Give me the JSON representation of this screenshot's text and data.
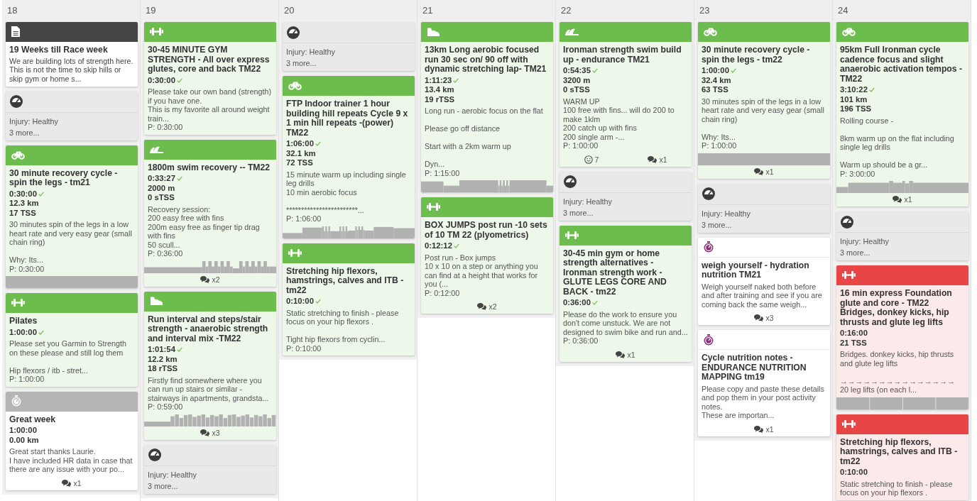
{
  "days": [
    {
      "label": "18",
      "items": [
        {
          "kind": "note",
          "title": "19 Weeks till Race week",
          "text": "We are building lots of strength here. This is not the time to skip hills or skip gym or home s..."
        },
        {
          "kind": "metrics",
          "lines": [
            "Injury: Healthy"
          ],
          "more": "3 more..."
        },
        {
          "kind": "bike",
          "color": "#6cbc4e",
          "title": "30 minute recovery cycle - spin the legs - tm21",
          "duration": "0:30:00",
          "completed": true,
          "distance": "12.3 km",
          "load": "17 TSS",
          "description": "30 minutes spin of the legs in a low heart rate and very easy gear (small chain ring)\n\nWhy: Its...",
          "planned": "P: 0:30:00",
          "graph": {
            "kind": "flat"
          }
        },
        {
          "kind": "strength",
          "color": "#6cbc4e",
          "title": "Pilates",
          "duration": "1:00:00",
          "completed": true,
          "description": "Please set you Garmin to Strength on these please and still log them\n\nHip flexors / itb - stret...",
          "planned": "P: 1:00:00"
        },
        {
          "kind": "other",
          "color": "#b5b5b5",
          "title": "Great week",
          "duration": "1:00:00",
          "completed": false,
          "distance": "0.00 km",
          "description": "Great start thanks Laurie.\nI have included HR data in case that there are any issue with your po...",
          "comments": "x1"
        }
      ]
    },
    {
      "label": "19",
      "items": [
        {
          "kind": "strength",
          "color": "#6cbc4e",
          "title": "30-45 MINUTE GYM STRENGTH - All over express glutes, core and back TM22",
          "duration": "0:30:00",
          "completed": true,
          "description": "Please take our own band (strength) if you have one.\nThis is my favorite all around weight train...",
          "planned": "P: 0:30:00"
        },
        {
          "kind": "swim",
          "color": "#6cbc4e",
          "title": "1800m swim recovery -- TM22",
          "duration": "0:33:27",
          "completed": true,
          "distance": "2000 m",
          "load": "0 sTSS",
          "description": "Recovery session:\n200 easy free with fins\n200m easy free as finger tip drag with fins\n50 scull...",
          "planned": "P: 0:36:00",
          "graph": {
            "kind": "swim"
          },
          "comments": "x2"
        },
        {
          "kind": "run",
          "color": "#6cbc4e",
          "title": "Run interval and steps/stair strength - anaerobic strength and interval mix -TM22",
          "duration": "1:01:54",
          "completed": true,
          "distance": "12.2 km",
          "load": "18 rTSS",
          "description": "Firstly find somewhere where you can run up stairs or similar - stairways in apartments, grandsta...",
          "planned": "P: 0:59:00",
          "graph": {
            "kind": "run"
          },
          "comments": "x3"
        },
        {
          "kind": "metrics",
          "lines": [
            "Injury: Healthy"
          ],
          "more": "3 more..."
        }
      ]
    },
    {
      "label": "20",
      "items": [
        {
          "kind": "metrics",
          "lines": [
            "Injury: Healthy"
          ],
          "more": "3 more..."
        },
        {
          "kind": "bike",
          "color": "#6cbc4e",
          "title": "FTP Indoor trainer 1 hour building hill repeats Cycle 9 x 1 min hill repeats -(power) TM22",
          "duration": "1:06:00",
          "completed": true,
          "distance": "32.1 km",
          "load": "72 TSS",
          "description": "15 minute warm up including single leg drills\n10 min aerobic focus\n\n************************...",
          "planned": "P: 1:06:00",
          "graph": {
            "kind": "ftp"
          }
        },
        {
          "kind": "strength",
          "color": "#6cbc4e",
          "title": "Stretching hip flexors, hamstrings, calves and ITB - tm22",
          "duration": "0:10:00",
          "completed": true,
          "description": "Static stretching to finish - please focus on your hip flexors .\n\nTight hip flexors from cyclin...",
          "planned": "P: 0:10:00"
        }
      ]
    },
    {
      "label": "21",
      "items": [
        {
          "kind": "run",
          "color": "#6cbc4e",
          "title": "13km Long aerobic focused run 30 sec on/ 90 off with dynamic stretching lap- TM21",
          "duration": "1:11:23",
          "completed": true,
          "distance": "13.4 km",
          "load": "19 rTSS",
          "description": "Long run - aerobic focus on the flat\n\nPlease go off distance\n\nStart with a 2km warm up\n\nDyn...",
          "planned": "P: 1:15:00",
          "graph": {
            "kind": "long_run"
          }
        },
        {
          "kind": "strength",
          "color": "#6cbc4e",
          "title": "BOX JUMPS post run -10 sets of 10 TM 22 (plyometrics)",
          "duration": "0:12:12",
          "completed": true,
          "description": "Post run - Box jumps\n10 x 10 on a step or anything you can find at a height that works for you (...",
          "planned": "P: 0:12:00",
          "comments": "x2"
        }
      ]
    },
    {
      "label": "22",
      "items": [
        {
          "kind": "swim",
          "color": "#6cbc4e",
          "title": "Ironman strength swim build up - endurance TM21",
          "duration": "0:54:35",
          "completed": true,
          "distance": "3200 m",
          "load": "0 sTSS",
          "description": "WARM UP\n100 free with fins... will do 200 to make 1klm\n200 catch up with fins\n200 single arm -...",
          "planned": "P: 1:00:00",
          "feel": "7",
          "comments": "x1"
        },
        {
          "kind": "metrics",
          "lines": [
            "Injury: Healthy"
          ],
          "more": "3 more..."
        },
        {
          "kind": "strength",
          "color": "#6cbc4e",
          "title": "30-45 min gym or home strength alternatives - Ironman strength work - GLUTE LEGS CORE AND BACK - tm22",
          "duration": "0:36:00",
          "completed": true,
          "description": "Please do the work to ensure you don't come unstuck. We are not designed to swim bike and run and...",
          "planned": "P: 0:36:00",
          "comments": "x1"
        }
      ]
    },
    {
      "label": "23",
      "items": [
        {
          "kind": "bike",
          "color": "#6cbc4e",
          "title": "30 minute recovery cycle - spin the legs - tm22",
          "duration": "1:00:00",
          "completed": true,
          "distance": "32.4 km",
          "load": "63 TSS",
          "description": "30 minutes spin of the legs in a low heart rate and very easy gear (small chain ring)\n\nWhy: Its...",
          "planned": "P: 1:00:00",
          "graph": {
            "kind": "flat"
          },
          "comments": "x1"
        },
        {
          "kind": "metrics",
          "lines": [
            "Injury: Healthy"
          ],
          "more": "3 more..."
        },
        {
          "kind": "other",
          "color": "#ffffff",
          "title": "weigh yourself - hydration nutrition TM21",
          "description": "Weigh yourself naked both before and after training and see if you are coming back the same weigh...",
          "comments": "x3"
        },
        {
          "kind": "other",
          "color": "#ffffff",
          "title": "Cycle nutrition notes - ENDURANCE NUTRITION MAPPING tm19",
          "description": "Please copy and paste these details and pop them in your post activity notes.\nThese are importan...",
          "comments": "x1"
        }
      ]
    },
    {
      "label": "24",
      "items": [
        {
          "kind": "bike",
          "color": "#6cbc4e",
          "title": "95km Full Ironman cycle cadence focus and slight anaerobic activation tempos - TM22",
          "duration": "3:10:22",
          "completed": true,
          "distance": "101 km",
          "load": "196 TSS",
          "description": "Rolling course -\n\n8km warm up on the flat including single leg drills\n\nWarm up should be a gr...",
          "planned": "P: 3:00:00",
          "graph": {
            "kind": "endurance"
          },
          "comments": "x1"
        },
        {
          "kind": "metrics",
          "lines": [
            "Injury: Healthy"
          ],
          "more": "3 more..."
        },
        {
          "kind": "strength",
          "color": "#e84646",
          "title": "16 min express Foundation glute and core - TM22 Bridges, donkey kicks, hip thrusts and glute leg lifts",
          "duration": "0:16:00",
          "completed": false,
          "load": "21 TSS",
          "description": "Bridges. donkey kicks, hip thrusts and glute leg lifts\n\n→→→→→→→→→→→→→→→\n20 leg lifts (on each l...",
          "graph": {
            "kind": "segments"
          }
        },
        {
          "kind": "strength",
          "color": "#e84646",
          "title": "Stretching hip flexors, hamstrings, calves and ITB - tm22",
          "duration": "0:10:00",
          "completed": false,
          "description": "Static stretching to finish - please focus on your hip flexors ."
        }
      ]
    }
  ]
}
